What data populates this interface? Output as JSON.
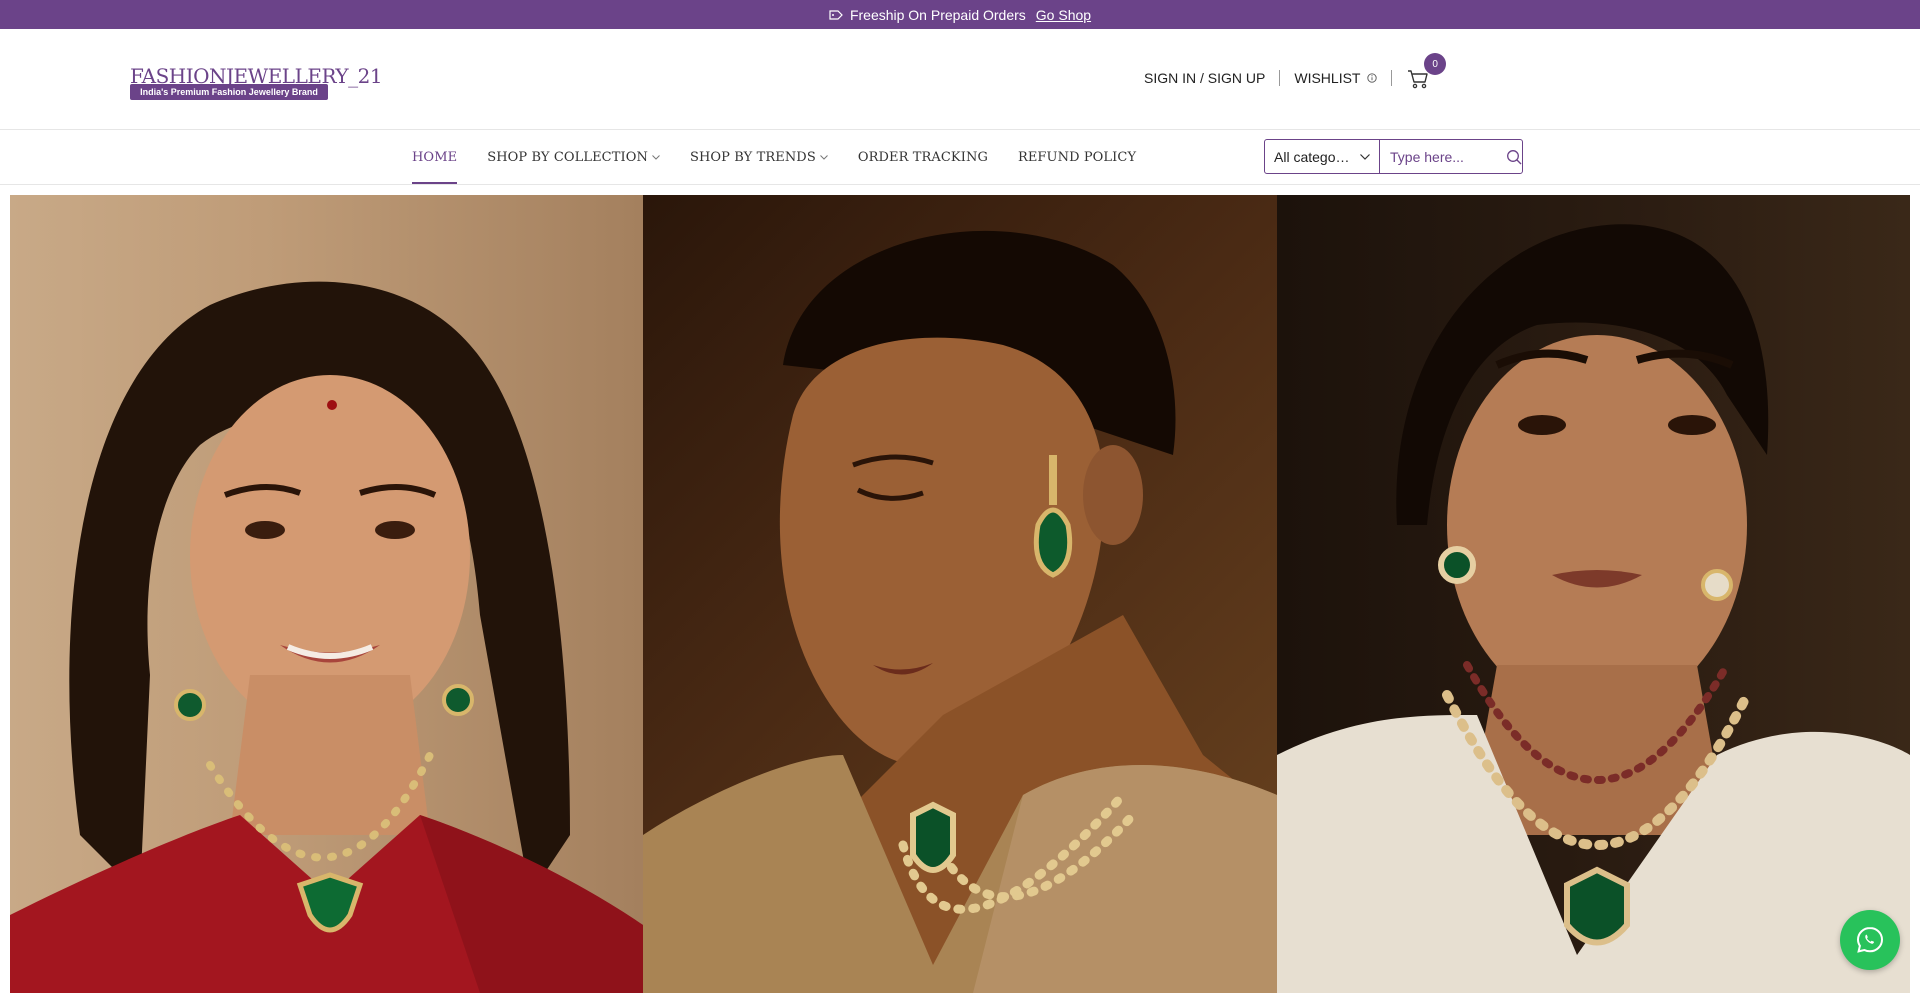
{
  "announcement": {
    "text": "Freeship On Prepaid Orders",
    "link": "Go Shop"
  },
  "brand": {
    "name": "FASHIONJEWELLERY_21",
    "tagline": "India's Premium Fashion Jewellery Brand"
  },
  "header": {
    "sign_in": "SIGN IN / SIGN UP",
    "wishlist": "WISHLIST",
    "cart_count": "0"
  },
  "nav": {
    "items": [
      {
        "label": "HOME",
        "active": true
      },
      {
        "label": "SHOP BY COLLECTION",
        "dropdown": true
      },
      {
        "label": "SHOP BY TRENDS",
        "dropdown": true
      },
      {
        "label": "ORDER TRACKING"
      },
      {
        "label": "REFUND POLICY"
      }
    ]
  },
  "search": {
    "category": "All categories",
    "placeholder": "Type here..."
  },
  "colors": {
    "brand": "#6b4389",
    "whatsapp": "#28c25b"
  },
  "hero": {
    "images": [
      "model-red-saree-emerald-necklace",
      "model-gold-saree-emerald-necklace",
      "model-ivory-blouse-emerald-necklace"
    ]
  }
}
